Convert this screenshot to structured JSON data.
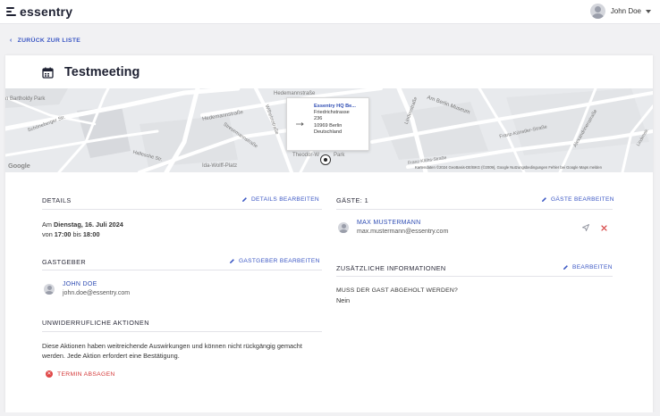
{
  "header": {
    "logo_text": "essentry",
    "user_name": "John Doe"
  },
  "nav": {
    "back_label": "ZURÜCK ZUR LISTE"
  },
  "meeting": {
    "title": "Testmeeting"
  },
  "map": {
    "popup_name": "Essentry HQ Be...",
    "popup_street": "Friedrichstrasse",
    "popup_number": "236",
    "popup_city": "10969 Berlin",
    "popup_country": "Deutschland",
    "streets": [
      "n Bartholdy Park",
      "Schöneberger Str.",
      "Hedemannstraße",
      "Hedemannstraße",
      "Wilhelmstraße",
      "Stresemannstraße",
      "Hallesche Str.",
      "Ida-Wolff-Platz",
      "Theodor-W",
      "Park",
      "Am Berlin Museum",
      "Lindenstraße",
      "Franz-Künstler-Straße",
      "Alexandrinenstraße",
      "Franz-Klühs-Straße",
      "Lindenstr."
    ],
    "google": "Google",
    "attribution": "Kartendaten ©2024 GeoBasis-DE/BKG (©2009), Google    Nutzungsbedingungen    Fehler bei Google Maps melden"
  },
  "details": {
    "heading": "DETAILS",
    "edit_label": "DETAILS BEARBEITEN",
    "date_prefix": "Am",
    "date": "Dienstag, 16. Juli 2024",
    "time_from_prefix": "von",
    "time_from": "17:00",
    "time_to_prefix": "bis",
    "time_to": "18:00"
  },
  "host": {
    "heading": "GASTGEBER",
    "edit_label": "GASTGEBER BEARBEITEN",
    "name": "JOHN DOE",
    "email": "john.doe@essentry.com"
  },
  "irrevocable": {
    "heading": "UNWIDERRUFLICHE AKTIONEN",
    "text_line1": "Diese Aktionen haben weitreichende Auswirkungen und können nicht rückgängig gemacht",
    "text_line2": "werden. Jede Aktion erfordert eine Bestätigung.",
    "cancel_label": "TERMIN ABSAGEN"
  },
  "guests": {
    "heading": "GÄSTE: 1",
    "edit_label": "GÄSTE BEARBEITEN",
    "items": [
      {
        "name": "MAX MUSTERMANN",
        "email": "max.mustermann@essentry.com"
      }
    ]
  },
  "additional": {
    "heading": "ZUSÄTZLICHE INFORMATIONEN",
    "edit_label": "BEARBEITEN",
    "question": "MUSS DER GAST ABGEHOLT WERDEN?",
    "answer": "Nein"
  },
  "colors": {
    "accent": "#3b57c4",
    "danger": "#d43a3a",
    "text": "#2b2b3a"
  },
  "icons": [
    "calendar-icon",
    "pencil-icon",
    "send-icon",
    "close-icon",
    "chevron-left-icon",
    "caret-down-icon",
    "avatar-icon"
  ]
}
